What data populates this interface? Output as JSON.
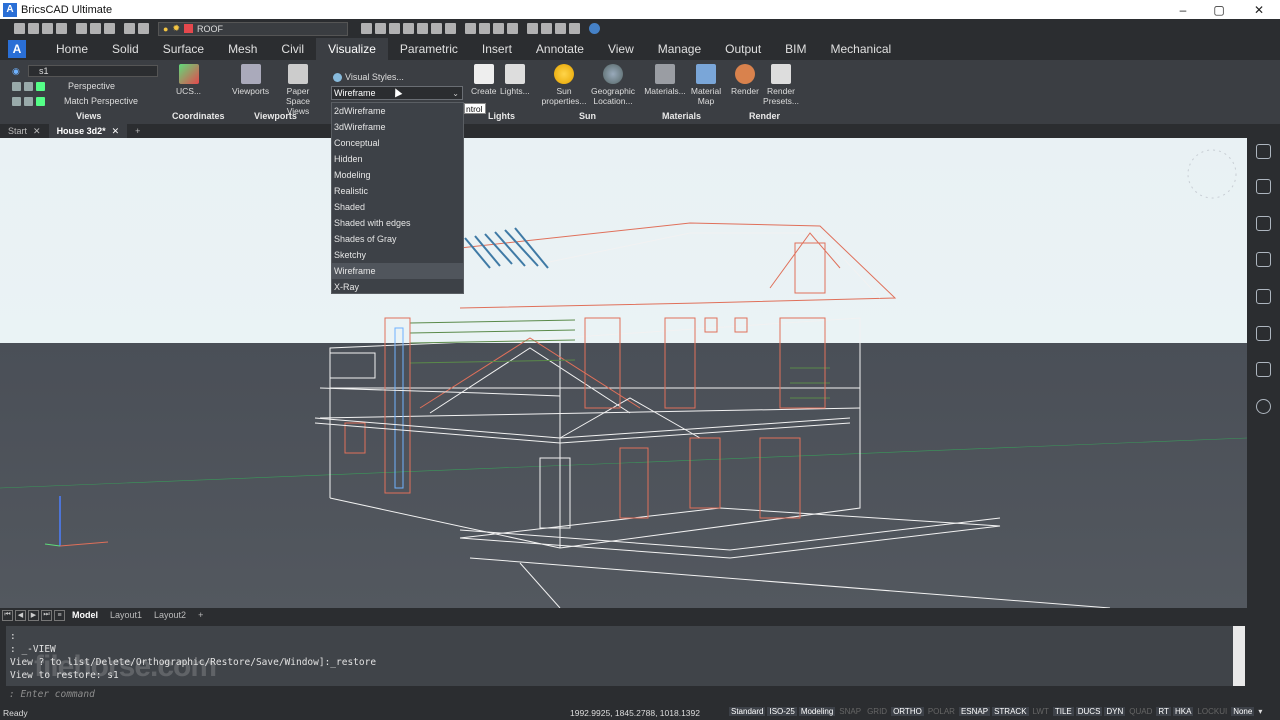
{
  "window": {
    "title": "BricsCAD Ultimate",
    "minimize": "–",
    "maximize": "▢",
    "close": "✕"
  },
  "quick_access": {
    "layer_name": "ROOF"
  },
  "ribbon_tabs": [
    "Home",
    "Solid",
    "Surface",
    "Mesh",
    "Civil",
    "Visualize",
    "Parametric",
    "Insert",
    "Annotate",
    "View",
    "Manage",
    "Output",
    "BIM",
    "Mechanical"
  ],
  "ribbon": {
    "views": {
      "view_name": "s1",
      "perspective": "Perspective",
      "match_perspective": "Match Perspective",
      "label": "Views"
    },
    "coordinates": {
      "ucs": "UCS...",
      "label": "Coordinates"
    },
    "viewports": {
      "viewports": "Viewports",
      "paper_space_views": "Paper Space Views",
      "label": "Viewports"
    },
    "visual_styles": {
      "button": "Visual Styles...",
      "current": "Wireframe"
    },
    "lights": {
      "create": "Create",
      "lights": "Lights...",
      "label": "Lights"
    },
    "sun": {
      "sun_properties": "Sun properties...",
      "geographic_location": "Geographic Location...",
      "label": "Sun"
    },
    "materials": {
      "materials": "Materials...",
      "material_map": "Material Map",
      "label": "Materials"
    },
    "render": {
      "render": "Render",
      "render_presets": "Render Presets...",
      "label": "Render"
    }
  },
  "visual_style_options": [
    "2dWireframe",
    "3dWireframe",
    "Conceptual",
    "Hidden",
    "Modeling",
    "Realistic",
    "Shaded",
    "Shaded with edges",
    "Shades of Gray",
    "Sketchy",
    "Wireframe",
    "X-Ray"
  ],
  "tooltip_fragment": "ntrol",
  "doc_tabs": {
    "start": "Start",
    "document": "House 3d2*",
    "add": "+"
  },
  "layout_tabs": [
    "Model",
    "Layout1",
    "Layout2"
  ],
  "layout_add": "+",
  "command_history": [
    ":",
    ": _-VIEW",
    "View ? to list/Delete/Orthographic/Restore/Save/Window]:_restore",
    "View to restore: s1"
  ],
  "command_prompt": ": Enter command",
  "watermark": "filehorse.com",
  "status": {
    "ready": "Ready",
    "coords": "1992.9925, 1845.2788, 1018.1392",
    "standard": "Standard",
    "iso": "ISO-25",
    "workspace": "Modeling",
    "toggles": [
      {
        "label": "SNAP",
        "on": false
      },
      {
        "label": "GRID",
        "on": false
      },
      {
        "label": "ORTHO",
        "on": true
      },
      {
        "label": "POLAR",
        "on": false
      },
      {
        "label": "ESNAP",
        "on": true
      },
      {
        "label": "STRACK",
        "on": true
      },
      {
        "label": "LWT",
        "on": false
      },
      {
        "label": "TILE",
        "on": true
      },
      {
        "label": "DUCS",
        "on": true
      },
      {
        "label": "DYN",
        "on": true
      },
      {
        "label": "QUAD",
        "on": false
      },
      {
        "label": "RT",
        "on": true
      },
      {
        "label": "HKA",
        "on": true
      },
      {
        "label": "LOCKUI",
        "on": false
      }
    ],
    "selection": "None"
  },
  "colors": {
    "accent": "#2a6fd6",
    "ribbon_bg": "#3b3e43",
    "sky": "#eaf3f5",
    "ground": "#4e535a",
    "wire_red": "#e0705a",
    "wire_white": "#f2f2f2"
  }
}
